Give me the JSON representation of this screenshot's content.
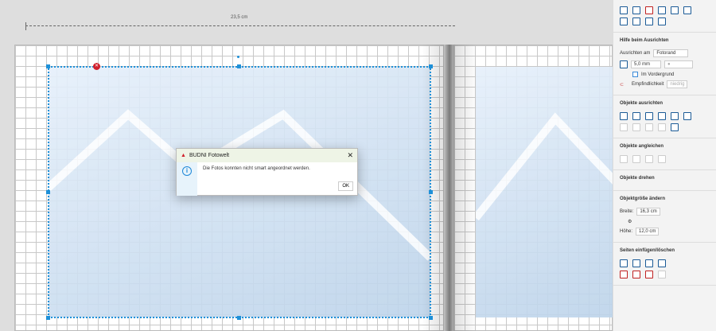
{
  "ruler": {
    "label": "23,5 cm"
  },
  "dialog": {
    "title": "BUDNI Fotowelt",
    "message": "Die Fotos konnten nicht smart angeordnet werden.",
    "ok": "OK",
    "close": "✕"
  },
  "panel": {
    "align_help": {
      "title": "Hilfe beim Ausrichten",
      "align_label": "Ausrichten am",
      "align_value": "Fotorand",
      "grid_value": "5,0 mm",
      "grid_dot": "●",
      "foreground": "Im Vordergrund",
      "sensitivity_label": "Empfindlichkeit",
      "sensitivity_value": "niedrig"
    },
    "align_objects": {
      "title": "Objekte ausrichten"
    },
    "match_objects": {
      "title": "Objekte angleichen"
    },
    "rotate_objects": {
      "title": "Objekte drehen"
    },
    "resize": {
      "title": "Objektgröße ändern",
      "width_label": "Breite:",
      "width_value": "16,3 cm",
      "height_label": "Höhe:",
      "height_value": "12,0 cm"
    },
    "pages": {
      "title": "Seiten einfügen/löschen"
    }
  },
  "colors": {
    "accent": "#1e90d8",
    "delete": "#d0202c"
  }
}
